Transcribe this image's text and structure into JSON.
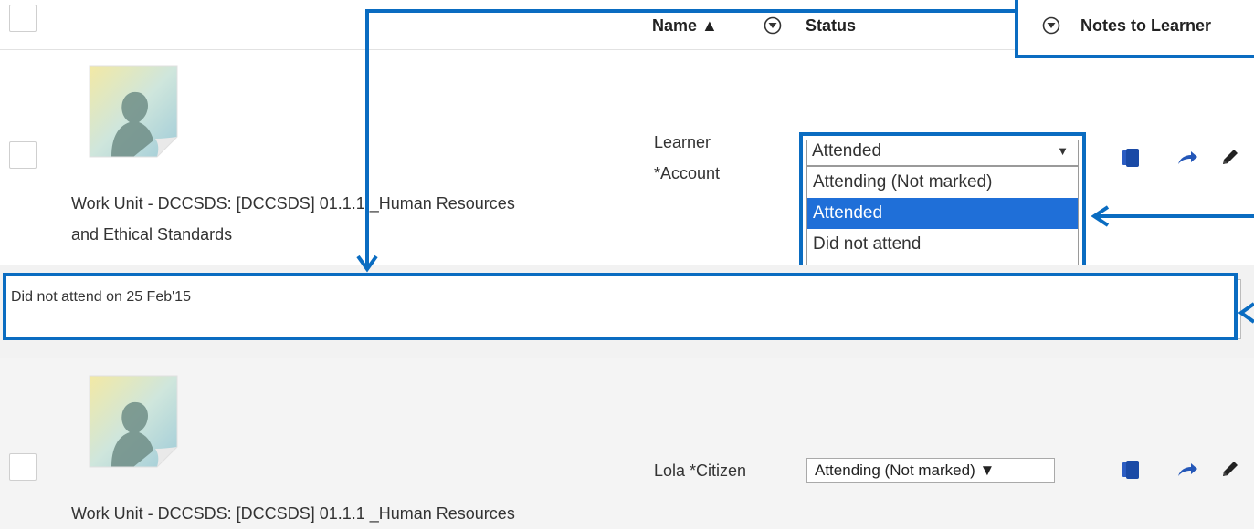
{
  "header": {
    "name_label": "Name ▲",
    "status_label": "Status",
    "notes_label": "Notes to Learner"
  },
  "rows": [
    {
      "title_line1": "Work Unit - DCCSDS: [DCCSDS] 01.1.1 _Human Resources",
      "title_line2": "and Ethical Standards",
      "name_line1": "Learner",
      "name_line2": "*Account",
      "status_selected": "Attended",
      "status_options": [
        "Attending (Not marked)",
        "Attended",
        "Did not attend"
      ],
      "note": "Did not attend on 25 Feb'15"
    },
    {
      "title_line1": "Work Unit - DCCSDS: [DCCSDS] 01.1.1 _Human Resources",
      "name": "Lola *Citizen",
      "status_selected": "Attending (Not marked) ▼"
    }
  ],
  "dropdown_arrow": "▼",
  "colors": {
    "annotation_blue": "#0a6cc1",
    "selected_option": "#1f6fd8",
    "icon_blue": "#1a4aa6"
  },
  "icons": [
    "filter-icon",
    "copy-icon",
    "share-arrow-icon",
    "edit-pencil-icon",
    "avatar-placeholder"
  ]
}
